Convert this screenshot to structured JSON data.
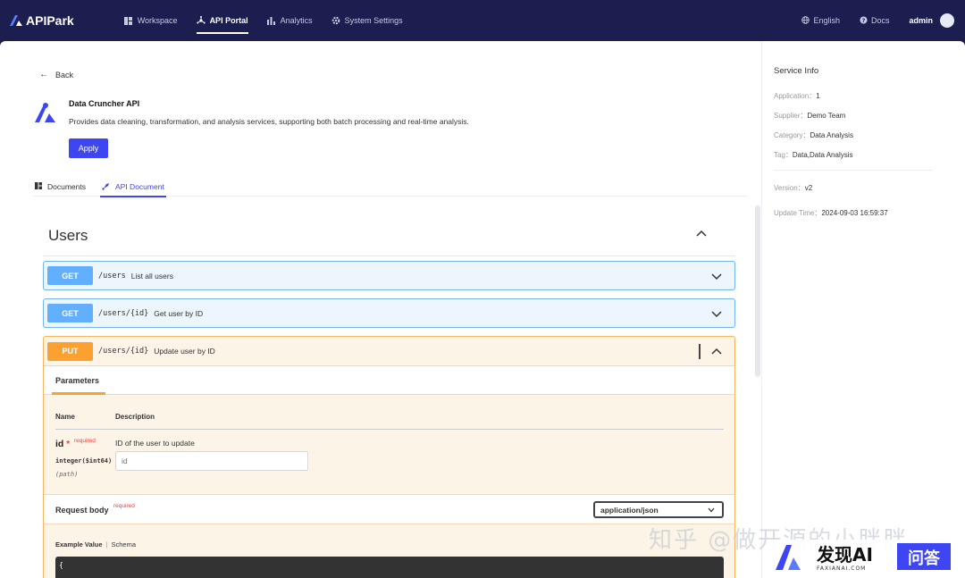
{
  "app": {
    "name": "APIPark"
  },
  "nav": {
    "items": [
      {
        "label": "Workspace",
        "icon": "grid-icon"
      },
      {
        "label": "API Portal",
        "icon": "network-icon",
        "active": true
      },
      {
        "label": "Analytics",
        "icon": "bar-chart-icon"
      },
      {
        "label": "System Settings",
        "icon": "gear-icon"
      }
    ],
    "language": "English",
    "docs": "Docs",
    "user": "admin"
  },
  "page": {
    "back_label": "Back",
    "api_title": "Data Cruncher API",
    "api_description": "Provides data cleaning, transformation, and analysis services, supporting both batch processing and real-time analysis.",
    "apply_label": "Apply",
    "tabs": [
      {
        "label": "Documents",
        "icon": "grid-icon"
      },
      {
        "label": "API Document",
        "icon": "rocket-icon",
        "active": true
      }
    ]
  },
  "section": {
    "title": "Users",
    "operations": [
      {
        "method": "GET",
        "path": "/users",
        "summary": "List all users",
        "expanded": false
      },
      {
        "method": "GET",
        "path": "/users/{id}",
        "summary": "Get user by ID",
        "expanded": false
      },
      {
        "method": "PUT",
        "path": "/users/{id}",
        "summary": "Update user by ID",
        "expanded": true
      }
    ]
  },
  "put_details": {
    "parameters_tab": "Parameters",
    "col_name": "Name",
    "col_description": "Description",
    "param": {
      "name": "id",
      "star": "*",
      "required": "required",
      "type": "integer($int64)",
      "in": "(path)",
      "description": "ID of the user to update",
      "placeholder": "id"
    },
    "request_body": {
      "title": "Request body",
      "required": "required",
      "content_type": "application/json"
    },
    "example_tabs": {
      "example": "Example Value",
      "schema": "Schema"
    },
    "code_first_line": "{"
  },
  "service_info": {
    "title": "Service Info",
    "rows": [
      {
        "key": "Application：",
        "value": "1"
      },
      {
        "key": "Supplier：",
        "value": "Demo Team"
      },
      {
        "key": "Category：",
        "value": "Data Analysis"
      },
      {
        "key": "Tag：",
        "value": "Data,Data Analysis"
      }
    ],
    "rows2": [
      {
        "key": "Version：",
        "value": "v2"
      },
      {
        "key": "Update Time：",
        "value": "2024-09-03 16:59:37"
      }
    ]
  },
  "watermark": {
    "text": "知乎 @做开源的小胖胖",
    "brand": "发现AI",
    "brand_sub": "FAXIANAI.COM",
    "badge": "问答"
  },
  "colors": {
    "topbar": "#1b1e4f",
    "accent": "#3d46f2",
    "get": "#61affe",
    "put": "#fca130"
  }
}
